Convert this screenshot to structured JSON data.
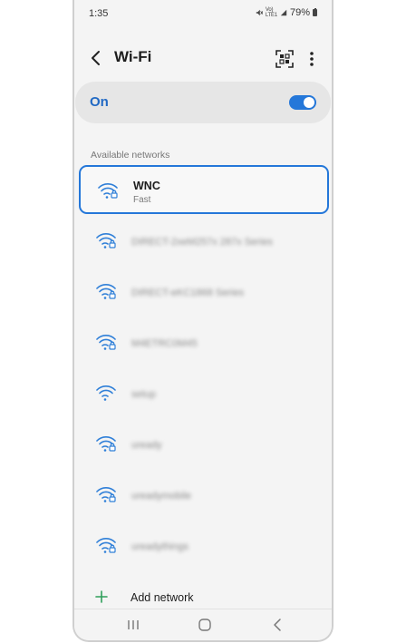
{
  "status": {
    "time": "1:35",
    "lte": "Vo)\nLTE1",
    "battery": "79%"
  },
  "header": {
    "title": "Wi-Fi",
    "back_icon": "chevron-left-icon",
    "qr_icon": "qr-scan-icon",
    "more_icon": "more-vertical-icon"
  },
  "toggle": {
    "label": "On",
    "state": "on",
    "accent": "#2477d9"
  },
  "section": {
    "available_label": "Available networks"
  },
  "networks": [
    {
      "name": "WNC",
      "sub": "Fast",
      "selected": true,
      "locked": true
    },
    {
      "name": "DIRECT-2xeM257x 287x Series",
      "locked": true,
      "blurred": true
    },
    {
      "name": "DIRECT-eKC1868 Series",
      "locked": true,
      "blurred": true
    },
    {
      "name": "M4ETRC0M45",
      "locked": true,
      "blurred": true
    },
    {
      "name": "setup",
      "locked": false,
      "blurred": true
    },
    {
      "name": "uready",
      "locked": true,
      "blurred": true
    },
    {
      "name": "ureadymobile",
      "locked": true,
      "blurred": true
    },
    {
      "name": "ureadythings",
      "locked": true,
      "blurred": true
    }
  ],
  "add_network": {
    "label": "Add network"
  },
  "navbar": {
    "recents_icon": "recents-icon",
    "home_icon": "home-icon",
    "back_icon": "back-icon"
  }
}
